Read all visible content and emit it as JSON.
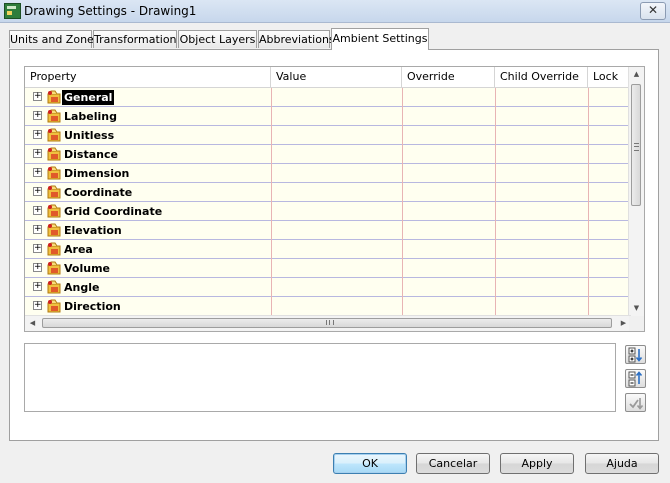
{
  "window": {
    "title": "Drawing Settings - Drawing1",
    "close_glyph": "✕"
  },
  "tabs": [
    {
      "label": "Units and Zone",
      "active": false
    },
    {
      "label": "Transformation",
      "active": false
    },
    {
      "label": "Object Layers",
      "active": false
    },
    {
      "label": "Abbreviations",
      "active": false
    },
    {
      "label": "Ambient Settings",
      "active": true
    }
  ],
  "grid": {
    "columns": [
      "Property",
      "Value",
      "Override",
      "Child Override",
      "Lock"
    ],
    "rows": [
      {
        "label": "General",
        "expander": "+",
        "selected": true
      },
      {
        "label": "Labeling",
        "expander": "+",
        "selected": false
      },
      {
        "label": "Unitless",
        "expander": "+",
        "selected": false
      },
      {
        "label": "Distance",
        "expander": "+",
        "selected": false
      },
      {
        "label": "Dimension",
        "expander": "+",
        "selected": false
      },
      {
        "label": "Coordinate",
        "expander": "+",
        "selected": false
      },
      {
        "label": "Grid Coordinate",
        "expander": "+",
        "selected": false
      },
      {
        "label": "Elevation",
        "expander": "+",
        "selected": false
      },
      {
        "label": "Area",
        "expander": "+",
        "selected": false
      },
      {
        "label": "Volume",
        "expander": "+",
        "selected": false
      },
      {
        "label": "Angle",
        "expander": "+",
        "selected": false
      },
      {
        "label": "Direction",
        "expander": "+",
        "selected": false
      }
    ],
    "icon": "category-settings-icon",
    "grid_line_color": "#b8b8e0",
    "column_divider_color": "#e8b4b4",
    "row_background": "#fffff0"
  },
  "side_tools": [
    "expand-all-icon",
    "collapse-all-icon",
    "apply-override-icon"
  ],
  "buttons": {
    "ok": "OK",
    "cancel": "Cancelar",
    "apply": "Apply",
    "help": "Ajuda"
  }
}
